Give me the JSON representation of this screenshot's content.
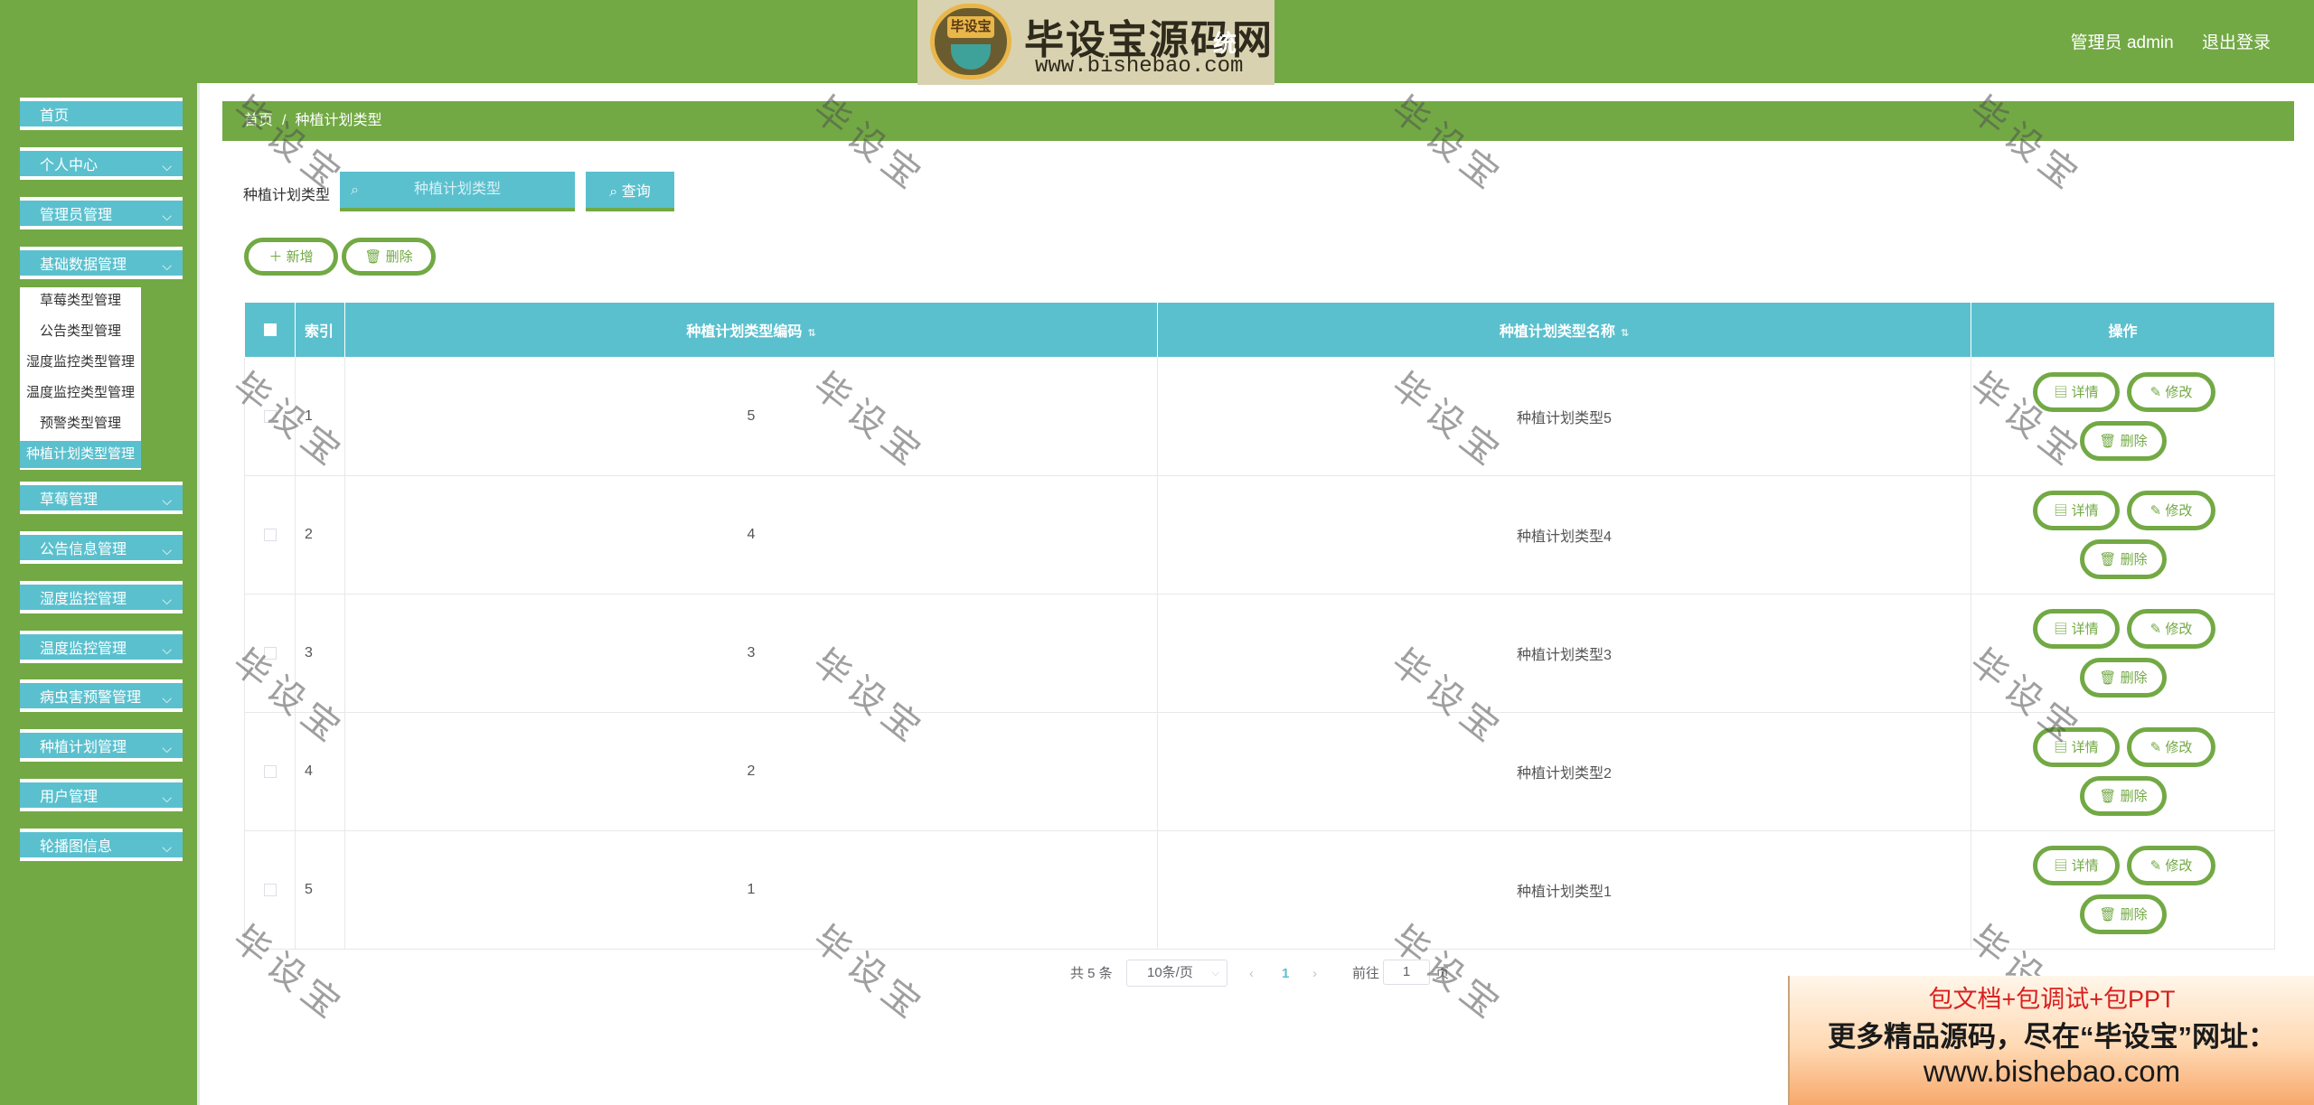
{
  "header": {
    "logo_badge": "毕设宝",
    "logo_title": "毕设宝源码网",
    "logo_url": "www.bishebao.com",
    "system_title_tail": "统",
    "admin_label": "管理员 admin",
    "logout_label": "退出登录"
  },
  "sidebar": {
    "home": "首页",
    "items": [
      {
        "label": "个人中心"
      },
      {
        "label": "管理员管理"
      },
      {
        "label": "基础数据管理"
      },
      {
        "label": "草莓管理"
      },
      {
        "label": "公告信息管理"
      },
      {
        "label": "湿度监控管理"
      },
      {
        "label": "温度监控管理"
      },
      {
        "label": "病虫害预警管理"
      },
      {
        "label": "种植计划管理"
      },
      {
        "label": "用户管理"
      },
      {
        "label": "轮播图信息"
      }
    ],
    "submenu": [
      {
        "label": "草莓类型管理"
      },
      {
        "label": "公告类型管理"
      },
      {
        "label": "湿度监控类型管理"
      },
      {
        "label": "温度监控类型管理"
      },
      {
        "label": "预警类型管理"
      },
      {
        "label": "种植计划类型管理"
      }
    ]
  },
  "breadcrumb": {
    "home": "首页",
    "separator": "/",
    "current": "种植计划类型"
  },
  "search": {
    "label": "种植计划类型",
    "placeholder": "种植计划类型",
    "query_label": "查询"
  },
  "actions": {
    "add_label": "新增",
    "delete_label": "删除"
  },
  "table": {
    "columns": {
      "index": "索引",
      "code": "种植计划类型编码",
      "name": "种植计划类型名称",
      "ops": "操作"
    },
    "rows": [
      {
        "index": "1",
        "code": "5",
        "name": "种植计划类型5"
      },
      {
        "index": "2",
        "code": "4",
        "name": "种植计划类型4"
      },
      {
        "index": "3",
        "code": "3",
        "name": "种植计划类型3"
      },
      {
        "index": "4",
        "code": "2",
        "name": "种植计划类型2"
      },
      {
        "index": "5",
        "code": "1",
        "name": "种植计划类型1"
      }
    ],
    "row_ops": {
      "detail": "详情",
      "edit": "修改",
      "delete": "删除"
    }
  },
  "pagination": {
    "total": "共 5 条",
    "page_size": "10条/页",
    "current_page": "1",
    "goto_label": "前往",
    "goto_value": "1",
    "page_unit": "页"
  },
  "watermark": "毕设宝",
  "promo": {
    "line1": "包文档+包调试+包PPT",
    "line2": "更多精品源码，尽在“毕设宝”网址：",
    "line3": "www.bishebao.com"
  },
  "colors": {
    "primary_green": "#72a944",
    "accent_cyan": "#5bc0ce"
  }
}
